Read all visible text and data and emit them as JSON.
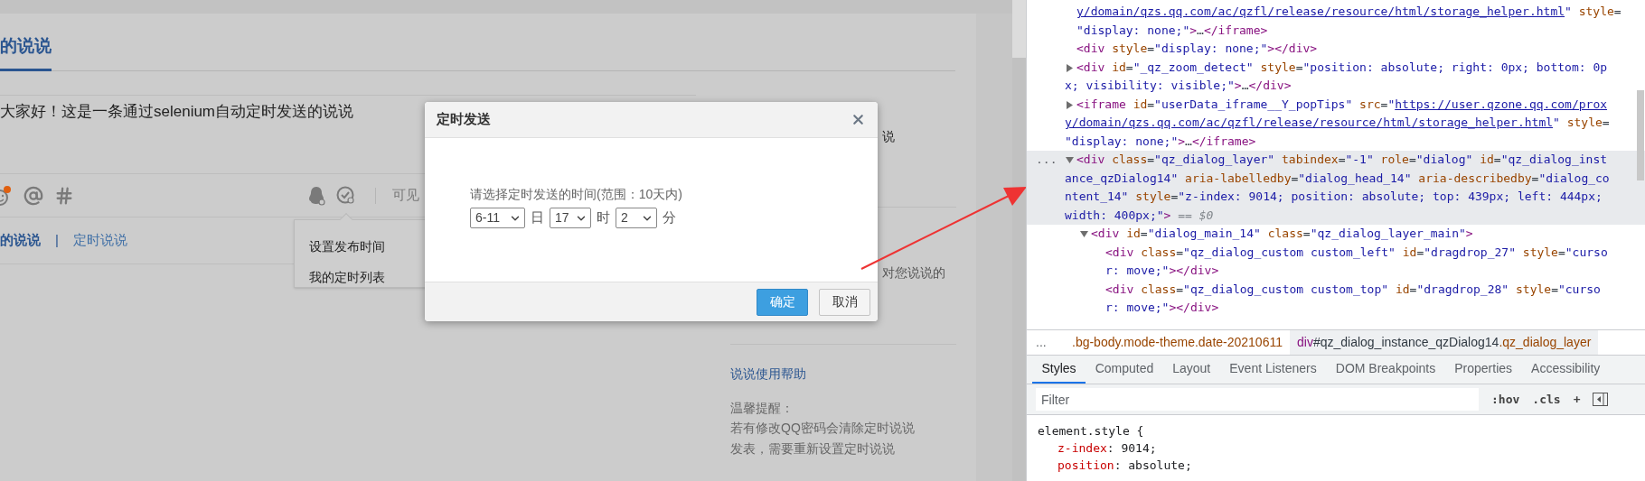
{
  "page": {
    "tab_title": "的说说",
    "post_text": "大家好！这是一条通过selenium自动定时发送的说说",
    "visibility_label": "可见",
    "subtabs": [
      {
        "label": "的说说",
        "selected": true
      },
      {
        "label": "定时说说",
        "selected": false
      }
    ],
    "subtab_separator": "|",
    "schedule_menu": [
      "设置发布时间",
      "我的定时列表"
    ],
    "sidebar": {
      "fragment_1": "说",
      "fragment_2": "对您说说的",
      "help_link": "说说使用帮助",
      "tip_title": "温馨提醒：",
      "tip_text": "若有修改QQ密码会清除定时说说发表，需要重新设置定时说说"
    }
  },
  "dialog": {
    "title": "定时发送",
    "prompt": "请选择定时发送的时间(范围：10天内)",
    "selects": [
      {
        "value": "6-11",
        "unit": "日"
      },
      {
        "value": "17",
        "unit": "时"
      },
      {
        "value": "2",
        "unit": "分"
      }
    ],
    "buttons": [
      {
        "label": "确定",
        "kind": "primary"
      },
      {
        "label": "取消",
        "kind": "secondary"
      }
    ]
  },
  "devtools": {
    "dom_nodes": [
      {
        "selected": false,
        "lines": [
          [
            {
              "kind": "link",
              "text": "y/domain/qzs.qq.com/ac/qzfl/release/resource/html/storage_helper.html"
            },
            {
              "kind": "value",
              "text": "\" "
            },
            {
              "kind": "attr",
              "text": "style"
            },
            {
              "kind": "plain",
              "text": "="
            }
          ],
          [
            {
              "kind": "value",
              "text": "\"display: none;\""
            },
            {
              "kind": "tag",
              "text": ">"
            },
            {
              "kind": "plain",
              "text": "…"
            },
            {
              "kind": "tag",
              "text": "</iframe>"
            }
          ]
        ]
      },
      {
        "selected": false,
        "lines": [
          [
            {
              "kind": "tag",
              "text": "<div "
            },
            {
              "kind": "attr",
              "text": "style"
            },
            {
              "kind": "plain",
              "text": "="
            },
            {
              "kind": "value",
              "text": "\"display: none;\""
            },
            {
              "kind": "tag",
              "text": "></div>"
            }
          ]
        ]
      },
      {
        "expanded": false,
        "selected": false,
        "lines": [
          [
            {
              "kind": "tag",
              "text": "<div "
            },
            {
              "kind": "attr",
              "text": "id"
            },
            {
              "kind": "plain",
              "text": "="
            },
            {
              "kind": "value",
              "text": "\"_qz_zoom_detect\" "
            },
            {
              "kind": "attr",
              "text": "style"
            },
            {
              "kind": "plain",
              "text": "="
            },
            {
              "kind": "value",
              "text": "\"position: absolute; right: 0px; bottom: 0p"
            }
          ],
          [
            {
              "kind": "value",
              "text": "x; visibility: visible;\""
            },
            {
              "kind": "tag",
              "text": ">"
            },
            {
              "kind": "plain",
              "text": "…"
            },
            {
              "kind": "tag",
              "text": "</div>"
            }
          ]
        ]
      },
      {
        "expanded": false,
        "selected": false,
        "lines": [
          [
            {
              "kind": "tag",
              "text": "<iframe "
            },
            {
              "kind": "attr",
              "text": "id"
            },
            {
              "kind": "plain",
              "text": "="
            },
            {
              "kind": "value",
              "text": "\"userData_iframe__Y_popTips\" "
            },
            {
              "kind": "attr",
              "text": "src"
            },
            {
              "kind": "plain",
              "text": "="
            },
            {
              "kind": "value",
              "text": "\""
            },
            {
              "kind": "link",
              "text": "https://user.qzone.qq.com/prox"
            }
          ],
          [
            {
              "kind": "link",
              "text": "y/domain/qzs.qq.com/ac/qzfl/release/resource/html/storage_helper.html"
            },
            {
              "kind": "value",
              "text": "\" "
            },
            {
              "kind": "attr",
              "text": "style"
            },
            {
              "kind": "plain",
              "text": "="
            }
          ],
          [
            {
              "kind": "value",
              "text": "\"display: none;\""
            },
            {
              "kind": "tag",
              "text": ">"
            },
            {
              "kind": "plain",
              "text": "…"
            },
            {
              "kind": "tag",
              "text": "</iframe>"
            }
          ]
        ]
      },
      {
        "expanded": true,
        "selected": true,
        "gutter": "...",
        "lines": [
          [
            {
              "kind": "tag",
              "text": "<div "
            },
            {
              "kind": "attr",
              "text": "class"
            },
            {
              "kind": "plain",
              "text": "="
            },
            {
              "kind": "value",
              "text": "\"qz_dialog_layer\" "
            },
            {
              "kind": "attr",
              "text": "tabindex"
            },
            {
              "kind": "plain",
              "text": "="
            },
            {
              "kind": "value",
              "text": "\"-1\" "
            },
            {
              "kind": "attr",
              "text": "role"
            },
            {
              "kind": "plain",
              "text": "="
            },
            {
              "kind": "value",
              "text": "\"dialog\" "
            },
            {
              "kind": "attr",
              "text": "id"
            },
            {
              "kind": "plain",
              "text": "="
            },
            {
              "kind": "value",
              "text": "\"qz_dialog_inst"
            }
          ],
          [
            {
              "kind": "value",
              "text": "ance_qzDialog14\" "
            },
            {
              "kind": "attr",
              "text": "aria-labelledby"
            },
            {
              "kind": "plain",
              "text": "="
            },
            {
              "kind": "value",
              "text": "\"dialog_head_14\" "
            },
            {
              "kind": "attr",
              "text": "aria-describedby"
            },
            {
              "kind": "plain",
              "text": "="
            },
            {
              "kind": "value",
              "text": "\"dialog_co"
            }
          ],
          [
            {
              "kind": "value",
              "text": "ntent_14\" "
            },
            {
              "kind": "attr",
              "text": "style"
            },
            {
              "kind": "plain",
              "text": "="
            },
            {
              "kind": "value",
              "text": "\"z-index: 9014; position: absolute; top: 439px; left: 444px;"
            }
          ],
          [
            {
              "kind": "value",
              "text": "width: 400px;\""
            },
            {
              "kind": "tag",
              "text": ">"
            },
            {
              "kind": "ref",
              "text": " == $0"
            }
          ]
        ],
        "children": [
          {
            "expanded": true,
            "selected": false,
            "lines": [
              [
                {
                  "kind": "tag",
                  "text": "<div "
                },
                {
                  "kind": "attr",
                  "text": "id"
                },
                {
                  "kind": "plain",
                  "text": "="
                },
                {
                  "kind": "value",
                  "text": "\"dialog_main_14\" "
                },
                {
                  "kind": "attr",
                  "text": "class"
                },
                {
                  "kind": "plain",
                  "text": "="
                },
                {
                  "kind": "value",
                  "text": "\"qz_dialog_layer_main\""
                },
                {
                  "kind": "tag",
                  "text": ">"
                }
              ]
            ],
            "children": [
              {
                "selected": false,
                "lines": [
                  [
                    {
                      "kind": "tag",
                      "text": "<div "
                    },
                    {
                      "kind": "attr",
                      "text": "class"
                    },
                    {
                      "kind": "plain",
                      "text": "="
                    },
                    {
                      "kind": "value",
                      "text": "\"qz_dialog_custom custom_left\" "
                    },
                    {
                      "kind": "attr",
                      "text": "id"
                    },
                    {
                      "kind": "plain",
                      "text": "="
                    },
                    {
                      "kind": "value",
                      "text": "\"dragdrop_27\" "
                    },
                    {
                      "kind": "attr",
                      "text": "style"
                    },
                    {
                      "kind": "plain",
                      "text": "="
                    },
                    {
                      "kind": "value",
                      "text": "\"curso"
                    }
                  ],
                  [
                    {
                      "kind": "value",
                      "text": "r: move;\""
                    },
                    {
                      "kind": "tag",
                      "text": "></div>"
                    }
                  ]
                ]
              },
              {
                "selected": false,
                "lines": [
                  [
                    {
                      "kind": "tag",
                      "text": "<div "
                    },
                    {
                      "kind": "attr",
                      "text": "class"
                    },
                    {
                      "kind": "plain",
                      "text": "="
                    },
                    {
                      "kind": "value",
                      "text": "\"qz_dialog_custom custom_top\" "
                    },
                    {
                      "kind": "attr",
                      "text": "id"
                    },
                    {
                      "kind": "plain",
                      "text": "="
                    },
                    {
                      "kind": "value",
                      "text": "\"dragdrop_28\" "
                    },
                    {
                      "kind": "attr",
                      "text": "style"
                    },
                    {
                      "kind": "plain",
                      "text": "="
                    },
                    {
                      "kind": "value",
                      "text": "\"curso"
                    }
                  ],
                  [
                    {
                      "kind": "value",
                      "text": "r: move;\""
                    },
                    {
                      "kind": "tag",
                      "text": "></div>"
                    }
                  ]
                ]
              }
            ]
          }
        ]
      }
    ],
    "breadcrumb_more": "...",
    "breadcrumbs": [
      {
        "selected": false,
        "parts": [
          {
            "kind": "attr",
            "text": ".bg-body.mode-theme.date-20210611"
          }
        ]
      },
      {
        "selected": true,
        "parts": [
          {
            "kind": "tag",
            "text": "div"
          },
          {
            "kind": "plain",
            "text": "#qz_dialog_instance_qzDialog14"
          },
          {
            "kind": "attr",
            "text": ".qz_dialog_layer"
          }
        ]
      }
    ],
    "tabs": [
      {
        "label": "Styles",
        "selected": true
      },
      {
        "label": "Computed",
        "selected": false
      },
      {
        "label": "Layout",
        "selected": false
      },
      {
        "label": "Event Listeners",
        "selected": false
      },
      {
        "label": "DOM Breakpoints",
        "selected": false
      },
      {
        "label": "Properties",
        "selected": false
      },
      {
        "label": "Accessibility",
        "selected": false
      }
    ],
    "filter": {
      "placeholder": "Filter"
    },
    "filter_actions": [
      ":hov",
      ".cls",
      "+"
    ],
    "styles": {
      "selector": "element.style {",
      "declarations": [
        {
          "property": "z-index",
          "separator": ":",
          "value": "9014;"
        },
        {
          "property": "position",
          "separator": ":",
          "value": "absolute;"
        }
      ]
    }
  }
}
